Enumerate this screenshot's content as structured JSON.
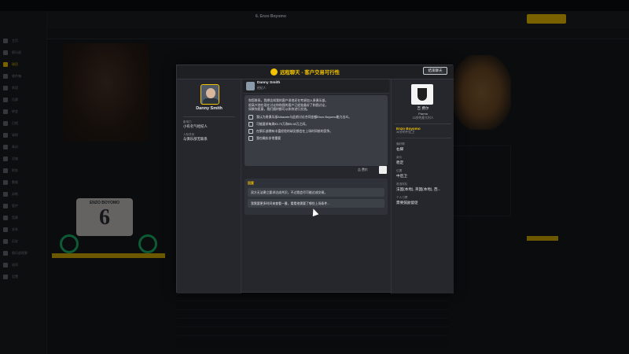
{
  "modal": {
    "title": "远程聊天 - 客户交易可行性",
    "end_button": "结束聊天"
  },
  "agent": {
    "name": "Danny Smith",
    "fields": [
      {
        "label": "影响力",
        "value": "小有名气经纪人"
      },
      {
        "label": "人际关系",
        "value": "与俱乐部无联系"
      }
    ]
  },
  "chat": {
    "sender_name": "Danny Smith",
    "sender_role": "经纪人",
    "message_lines": [
      "和您联系，我想告知我的客户说他还在考虑加入贵俱乐部。",
      "很高兴他在现在讨论你和我的客户已经准备好了和我讨论，",
      "如果你愿意，我们随时都可以和你进行交流。"
    ],
    "options": [
      "我认为贵俱乐部Albacete与此前讨论合同金额Enzo Boyomo能力出众。",
      "可能要求每周€3.70万和€5.08万之间。",
      "在俱乐部拥有丰富经验的球员都会在上场时间前的竞争。",
      "我也确实非常重要"
    ],
    "sign_name": "吉 费尔",
    "reply_header": "回复",
    "replies": [
      "双方无法建立要求达成共识，不过我会尽可能达成交易。",
      "我需要更多时间来查看一番，看看他需要了哪些上场条件..."
    ]
  },
  "club": {
    "person": "吉 费尔",
    "team": "Parma",
    "rep": "33岁的意大利人",
    "player_link": "Enzo Boyomo",
    "player_sub": "30岁的中后卫",
    "info": [
      {
        "label": "偏好脚",
        "value": "右脚"
      },
      {
        "label": "身价",
        "value": "稳定"
      },
      {
        "label": "位置",
        "value": "中后卫"
      },
      {
        "label": "首选球队",
        "value": "法国(本地), 英国(本地), 西..."
      },
      {
        "label": "个人习惯",
        "value": "需要鼓励督促"
      }
    ]
  },
  "background": {
    "player_name": "6. Enzo Boyomo",
    "jersey_name": "ENZO BOYOMO",
    "jersey_number": "6",
    "sidebar": [
      "主页",
      "俱乐部",
      "球员",
      "收件箱",
      "阵容",
      "比赛",
      "转会",
      "日程",
      "球探",
      "青训",
      "设施",
      "财务",
      "数据",
      "训练",
      "医疗",
      "竞赛",
      "关系",
      "历史",
      "俱乐部视野",
      "选项",
      "设置"
    ],
    "top_tabs": [
      "资料",
      "个人",
      "合同",
      "历史",
      "对比",
      "报告",
      "转会",
      "发展"
    ]
  }
}
